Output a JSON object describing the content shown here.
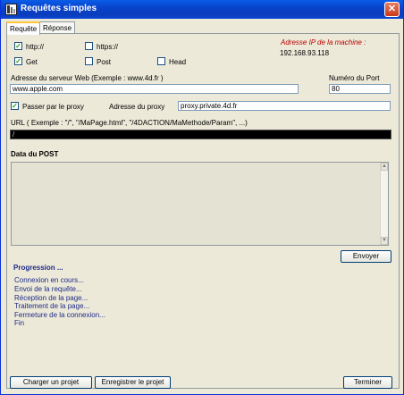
{
  "window": {
    "title": "Requêtes simples",
    "close_glyph": "✕"
  },
  "tabs": [
    {
      "label": "Requête",
      "active": true
    },
    {
      "label": "Réponse",
      "active": false
    }
  ],
  "protocol": {
    "http": {
      "label": "http://",
      "checked": true
    },
    "https": {
      "label": "https://",
      "checked": false
    }
  },
  "method": {
    "get": {
      "label": "Get",
      "checked": true
    },
    "post": {
      "label": "Post",
      "checked": false
    },
    "head": {
      "label": "Head",
      "checked": false
    }
  },
  "machine": {
    "label": "Adresse IP de la machine :",
    "ip": "192.168.93.118"
  },
  "server": {
    "label": "Adresse du serveur Web (Exemple : www.4d.fr )",
    "value": "www.apple.com"
  },
  "port": {
    "label": "Numéro du Port",
    "value": "80"
  },
  "proxy": {
    "checkbox_label": "Passer par le proxy",
    "checked": true,
    "address_label": "Adresse du proxy",
    "address_value": "proxy.private.4d.fr"
  },
  "url": {
    "label": "URL ( Exemple : \"/\", \"/MaPage.html\", \"/4DACTION/MaMethode/Param\", ...)",
    "value": "/"
  },
  "post_data": {
    "label": "Data du POST",
    "value": ""
  },
  "send_button": "Envoyer",
  "progression": {
    "title": "Progression ...",
    "steps": [
      "Connexion en cours...",
      "Envoi de la requête...",
      "Réception de la page...",
      "Traitement de la page...",
      "Fermeture de la connexion...",
      "Fin"
    ]
  },
  "footer": {
    "load_button": "Charger un projet",
    "save_button": "Enregistrer le projet",
    "finish_button": "Terminer"
  },
  "colors": {
    "titlebar": "#0842c8",
    "highlight_red": "#b80000",
    "progress_blue": "#1e2b88",
    "panel_bg": "#ece9d8"
  },
  "icons": {
    "app": "4d-app-icon",
    "close": "close-icon",
    "check": "checkmark-icon",
    "scroll_up": "arrow-up-icon",
    "scroll_down": "arrow-down-icon"
  }
}
